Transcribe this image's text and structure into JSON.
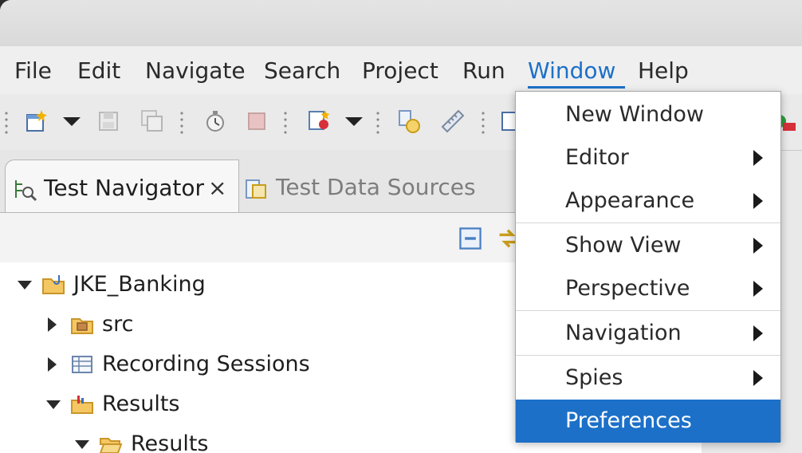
{
  "menubar": {
    "items": [
      {
        "label": "File"
      },
      {
        "label": "Edit"
      },
      {
        "label": "Navigate"
      },
      {
        "label": "Search"
      },
      {
        "label": "Project"
      },
      {
        "label": "Run"
      },
      {
        "label": "Window"
      },
      {
        "label": "Help"
      }
    ],
    "active": "Window"
  },
  "tabs": {
    "active": {
      "label": "Test Navigator",
      "close": "×"
    },
    "inactive": {
      "label": "Test Data Sources"
    }
  },
  "tree": {
    "rows": [
      {
        "label": "JKE_Banking",
        "expanded": true
      },
      {
        "label": "src",
        "expanded": false
      },
      {
        "label": "Recording Sessions",
        "expanded": false
      },
      {
        "label": "Results",
        "expanded": true
      },
      {
        "label": "Results",
        "expanded": true
      }
    ]
  },
  "window_menu": {
    "items": [
      {
        "label": "New Window",
        "submenu": false
      },
      {
        "label": "Editor",
        "submenu": true
      },
      {
        "label": "Appearance",
        "submenu": true
      },
      {
        "label": "Show View",
        "submenu": true
      },
      {
        "label": "Perspective",
        "submenu": true
      },
      {
        "label": "Navigation",
        "submenu": true
      },
      {
        "label": "Spies",
        "submenu": true
      },
      {
        "label": "Preferences",
        "submenu": false,
        "highlighted": true
      }
    ]
  },
  "colors": {
    "accent": "#1c70c8",
    "menu_background": "#ffffff",
    "toolbar_background": "#eaeaea"
  }
}
